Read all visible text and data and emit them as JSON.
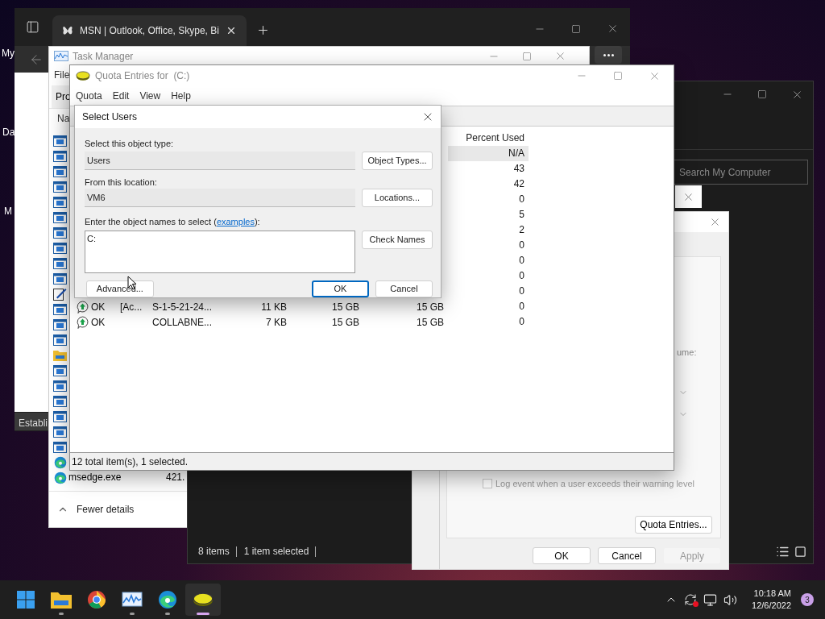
{
  "desktop": {
    "labels": [
      "My",
      "Da",
      "M"
    ],
    "tooltip": "Establi"
  },
  "browser": {
    "tabs": [
      {
        "title": "MSN | Outlook, Office, Skype, Bi",
        "selected": true
      }
    ]
  },
  "task_manager": {
    "title": "Task Manager",
    "menu": [
      "File"
    ],
    "tabs": [
      {
        "label": "Pro",
        "selected": true
      }
    ],
    "column": "Na",
    "processes": [
      {
        "kind": "app"
      },
      {
        "kind": "app"
      },
      {
        "kind": "app"
      },
      {
        "kind": "app"
      },
      {
        "kind": "app"
      },
      {
        "kind": "app"
      },
      {
        "kind": "app"
      },
      {
        "kind": "app"
      },
      {
        "kind": "app"
      },
      {
        "kind": "app"
      },
      {
        "kind": "notepad"
      },
      {
        "kind": "app"
      },
      {
        "kind": "app"
      },
      {
        "kind": "app"
      },
      {
        "kind": "folder"
      },
      {
        "kind": "app"
      },
      {
        "kind": "app"
      },
      {
        "kind": "app"
      },
      {
        "kind": "app"
      },
      {
        "kind": "app"
      },
      {
        "kind": "app"
      },
      {
        "kind": "edge"
      },
      {
        "kind": "edge",
        "name": "msedge.exe",
        "memory": "421."
      }
    ],
    "footer": "Fewer details"
  },
  "explorer": {
    "search": {
      "placeholder": "Search My Computer"
    },
    "status": [
      "8 items",
      "1 item selected"
    ]
  },
  "properties": {
    "fragment": "ume:",
    "log_event": {
      "label": "Log event when a user exceeds their warning level",
      "checked": false,
      "disabled": true
    },
    "quota_entries_button": "Quota Entries...",
    "buttons": [
      {
        "label": "OK",
        "disabled": false
      },
      {
        "label": "Cancel",
        "disabled": false
      },
      {
        "label": "Apply",
        "disabled": true
      }
    ]
  },
  "quota_window": {
    "title": "Quota Entries for  (C:)",
    "menu": [
      "Quota",
      "Edit",
      "View",
      "Help"
    ],
    "percent_header": "Percent Used",
    "rows": [
      {
        "percent": "N/A",
        "selected": true
      },
      {
        "percent": "43",
        "selected": false
      },
      {
        "percent": "42",
        "selected": false
      },
      {
        "percent": "0",
        "selected": false
      },
      {
        "percent": "5",
        "selected": false
      },
      {
        "percent": "2",
        "selected": false
      },
      {
        "percent": "0",
        "selected": false
      },
      {
        "percent": "0",
        "selected": false
      },
      {
        "percent": "0",
        "selected": false
      },
      {
        "percent": "0",
        "selected": false
      },
      {
        "status": "OK",
        "name": "[Ac...",
        "logon": "S-1-5-21-24...",
        "used": "11 KB",
        "limit": "15 GB",
        "warning": "15 GB",
        "percent": "0",
        "selected": false
      },
      {
        "status": "OK",
        "logon": "COLLABNE...",
        "used": "7 KB",
        "limit": "15 GB",
        "warning": "15 GB",
        "percent": "0",
        "selected": false
      }
    ],
    "status_bar": "12 total item(s), 1 selected."
  },
  "select_users": {
    "title": "Select Users",
    "type_label": "Select this object type:",
    "type_value": "Users",
    "type_button": "Object Types...",
    "location_label": "From this location:",
    "location_value": "VM6",
    "location_button": "Locations...",
    "prompt": {
      "before": "Enter the object names to select (",
      "link": "examples",
      "after": "):"
    },
    "names_value": "C:",
    "check_button": "Check Names",
    "buttons": [
      {
        "label": "Advanced...",
        "default": false
      },
      {
        "label": "OK",
        "default": true
      },
      {
        "label": "Cancel",
        "default": false
      }
    ]
  },
  "taskbar": {
    "apps": [
      {
        "kind": "start",
        "running": false,
        "selected": false
      },
      {
        "kind": "folder",
        "running": true,
        "selected": false
      },
      {
        "kind": "chrome",
        "running": false,
        "selected": false
      },
      {
        "kind": "monitor",
        "running": true,
        "selected": false
      },
      {
        "kind": "edge",
        "running": true,
        "selected": false
      },
      {
        "kind": "disk",
        "running": true,
        "selected": true
      }
    ],
    "time": "10:18 AM",
    "date": "12/6/2022",
    "badge": "3"
  }
}
